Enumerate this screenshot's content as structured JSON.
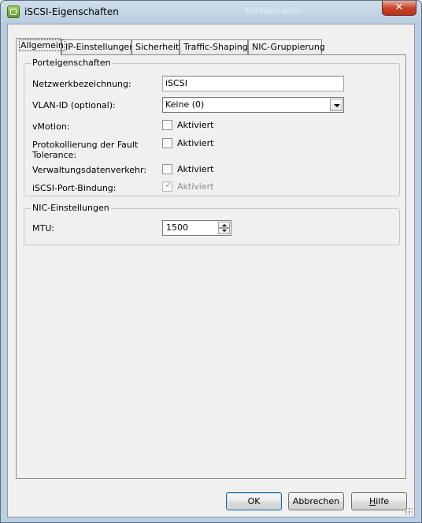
{
  "window": {
    "title": "iSCSI-Eigenschaften",
    "background_title": "Konfiguration"
  },
  "tabs": [
    {
      "label": "Allgemein",
      "active": true
    },
    {
      "label": "IP-Einstellungen",
      "active": false
    },
    {
      "label": "Sicherheit",
      "active": false
    },
    {
      "label": "Traffic-Shaping",
      "active": false
    },
    {
      "label": "NIC-Gruppierung",
      "active": false
    }
  ],
  "port_properties": {
    "legend": "Porteigenschaften",
    "network_label": {
      "label": "Netzwerkbezeichnung:",
      "value": "iSCSI"
    },
    "vlan": {
      "label": "VLAN-ID (optional):",
      "value": "Keine (0)"
    },
    "vmotion": {
      "label": "vMotion:",
      "checkbox_label": "Aktiviert",
      "checked": false
    },
    "fault_tolerance": {
      "label": "Protokollierung der Fault Tolerance:",
      "checkbox_label": "Aktiviert",
      "checked": false
    },
    "management": {
      "label": "Verwaltungsdatenverkehr:",
      "checkbox_label": "Aktiviert",
      "checked": false
    },
    "iscsi_binding": {
      "label": "iSCSI-Port-Bindung:",
      "checkbox_label": "Aktiviert",
      "checked": true,
      "disabled": true
    }
  },
  "nic_settings": {
    "legend": "NIC-Einstellungen",
    "mtu": {
      "label": "MTU:",
      "value": "1500"
    }
  },
  "buttons": {
    "ok": "OK",
    "cancel": "Abbrechen",
    "help": "Hilfe"
  },
  "colors": {
    "title_bar": "#bcd0e2",
    "close_button": "#c6452d",
    "dialog_bg": "#f0f0f0",
    "default_button_border": "#2c628b"
  }
}
